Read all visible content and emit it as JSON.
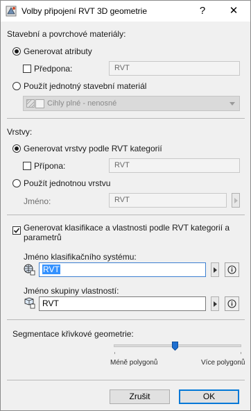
{
  "window": {
    "title": "Volby připojení RVT 3D geometrie",
    "help_label": "?",
    "close_label": "✕"
  },
  "materials": {
    "heading": "Stavební a povrchové materiály:",
    "option_generate": "Generovat atributy",
    "prefix_label": "Předpona:",
    "prefix_value": "RVT",
    "option_single": "Použít jednotný stavební materiál",
    "material_value": "Cihly plné - nenosné"
  },
  "layers": {
    "heading": "Vrstvy:",
    "option_generate": "Generovat vrstvy podle RVT kategorií",
    "suffix_label": "Přípona:",
    "suffix_value": "RVT",
    "option_single": "Použít jednotnou vrstvu",
    "name_label": "Jméno:",
    "name_value": "RVT"
  },
  "classification": {
    "checkbox_label_line1": "Generovat klasifikace a vlastnosti podle RVT kategorií a",
    "checkbox_label_line2": "parametrů",
    "system_label": "Jméno klasifikačního systému:",
    "system_value": "RVT",
    "group_label": "Jméno skupiny vlastností:",
    "group_value": "RVT"
  },
  "segmentation": {
    "heading": "Segmentace křivkové geometrie:",
    "min_label": "Méně polygonů",
    "max_label": "Více polygonů",
    "level_fraction": 0.48
  },
  "buttons": {
    "cancel": "Zrušit",
    "ok": "OK"
  },
  "colors": {
    "accent": "#0078d7",
    "selection": "#3391ff",
    "thumb": "#1e6fd0"
  }
}
